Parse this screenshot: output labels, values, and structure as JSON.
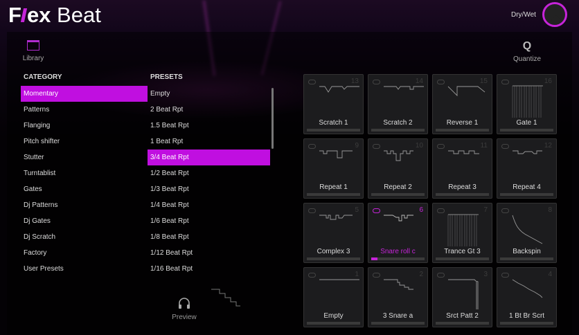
{
  "app": {
    "logo": "Flex Beat",
    "logo_part1": "F",
    "logo_part2": "ex",
    "logo_part3": "Beat"
  },
  "header": {
    "drywet_label": "Dry/Wet"
  },
  "toolbar": {
    "library": "Library",
    "quantize_icon": "Q",
    "quantize": "Quantize",
    "preview": "Preview"
  },
  "category": {
    "title": "CATEGORY",
    "selected": 0,
    "items": [
      "Momentary",
      "Patterns",
      "Flanging",
      "Pitch shifter",
      "Stutter",
      "Turntablist",
      "Gates",
      "Dj Patterns",
      "Dj Gates",
      "Dj Scratch",
      "Factory",
      "User Presets"
    ]
  },
  "presets": {
    "title": "PRESETS",
    "selected": 4,
    "items": [
      "Empty",
      "2 Beat Rpt",
      "1.5 Beat Rpt",
      "1 Beat Rpt",
      "3/4 Beat Rpt",
      "1/2 Beat Rpt",
      "1/3 Beat Rpt",
      "1/4 Beat Rpt",
      "1/6 Beat Rpt",
      "1/8 Beat Rpt",
      "1/12 Beat Rpt",
      "1/16 Beat Rpt"
    ]
  },
  "pads": [
    {
      "num": "13",
      "name": "Scratch 1",
      "wave": "scratch1"
    },
    {
      "num": "14",
      "name": "Scratch 2",
      "wave": "scratch2"
    },
    {
      "num": "15",
      "name": "Reverse 1",
      "wave": "reverse"
    },
    {
      "num": "16",
      "name": "Gate 1",
      "wave": "gate"
    },
    {
      "num": "9",
      "name": "Repeat 1",
      "wave": "rep1"
    },
    {
      "num": "10",
      "name": "Repeat 2",
      "wave": "rep2"
    },
    {
      "num": "11",
      "name": "Repeat 3",
      "wave": "rep3"
    },
    {
      "num": "12",
      "name": "Repeat 4",
      "wave": "rep4"
    },
    {
      "num": "5",
      "name": "Complex 3",
      "wave": "complex"
    },
    {
      "num": "6",
      "name": "Snare roll c",
      "wave": "snare",
      "active": true,
      "progress": 0.12
    },
    {
      "num": "7",
      "name": "Trance Gt 3",
      "wave": "gate"
    },
    {
      "num": "8",
      "name": "Backspin",
      "wave": "backspin"
    },
    {
      "num": "1",
      "name": "Empty",
      "wave": "flat"
    },
    {
      "num": "2",
      "name": "3 Snare a",
      "wave": "stairs"
    },
    {
      "num": "3",
      "name": "Srct Patt 2",
      "wave": "srct"
    },
    {
      "num": "4",
      "name": "1 Bt Br Scrt",
      "wave": "diag"
    }
  ],
  "colors": {
    "accent": "#c624d9",
    "selection": "#c00fe0"
  }
}
